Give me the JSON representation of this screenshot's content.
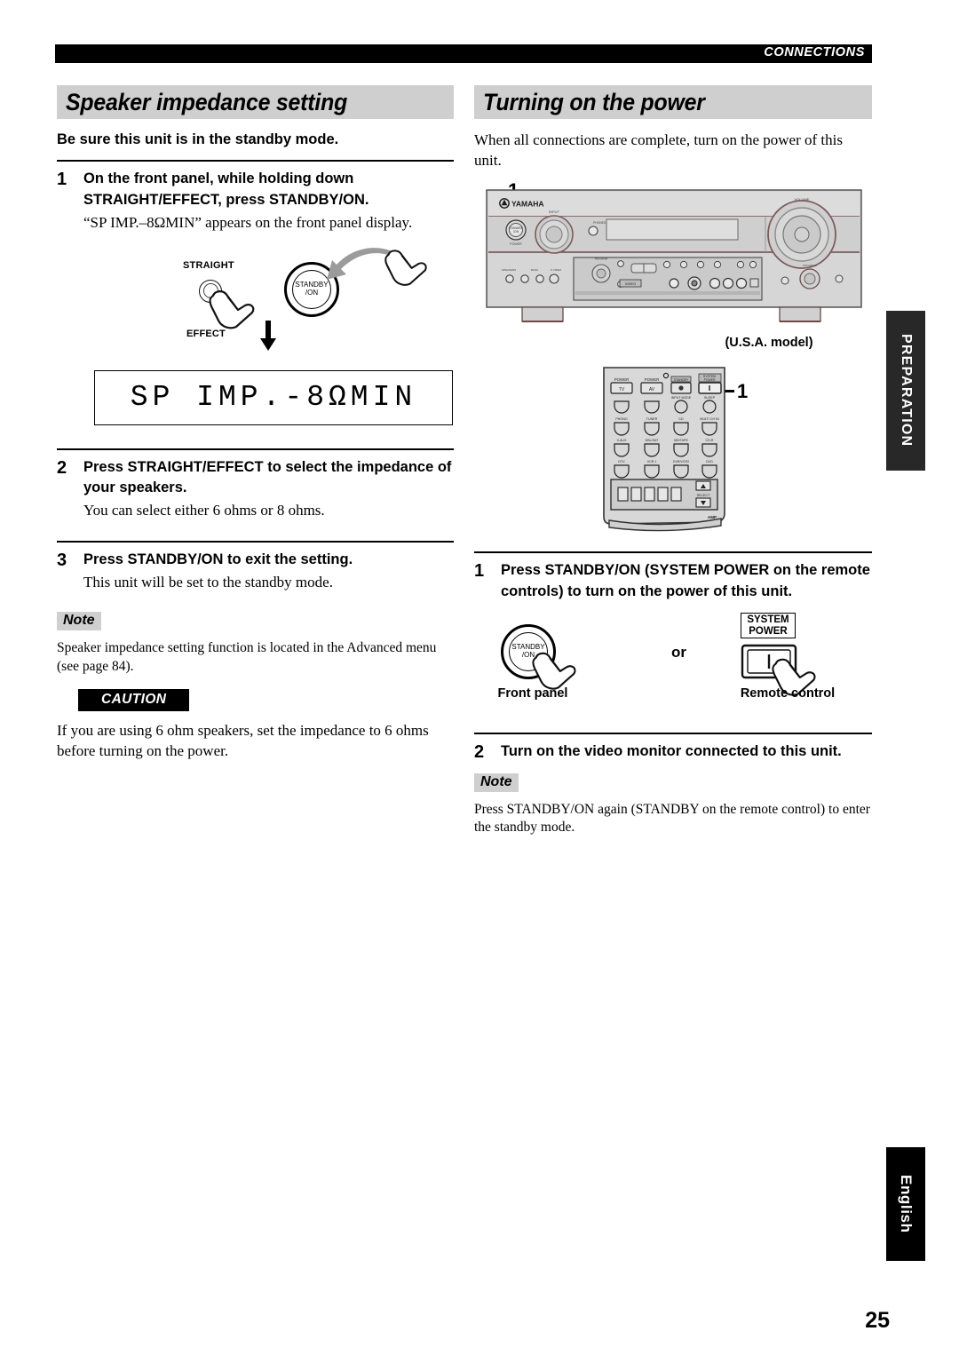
{
  "header": {
    "breadcrumb": "CONNECTIONS"
  },
  "page_number": "25",
  "side_tabs": {
    "preparation": "PREPARATION",
    "english": "English"
  },
  "left_column": {
    "section_title": "Speaker impedance setting",
    "intro": "Be sure this unit is in the standby mode.",
    "steps": [
      {
        "num": "1",
        "title": "On the front panel, while holding down STRAIGHT/EFFECT, press STANDBY/ON.",
        "desc": "“SP IMP.–8ΩMIN” appears on the front panel display."
      },
      {
        "num": "2",
        "title": "Press STRAIGHT/EFFECT to select the impedance of your speakers.",
        "desc": "You can select either 6 ohms or 8 ohms."
      },
      {
        "num": "3",
        "title": "Press STANDBY/ON to exit the setting.",
        "desc": "This unit will be set to the standby mode."
      }
    ],
    "diagram": {
      "label_straight": "STRAIGHT",
      "label_effect": "EFFECT",
      "label_standby_line1": "STANDBY",
      "label_standby_line2": "/ON"
    },
    "display_text": "SP IMP.-8ΩMIN",
    "note_tag": "Note",
    "note_body": "Speaker impedance setting function is located in the Advanced menu (see page 84).",
    "caution_tag": "CAUTION",
    "caution_body": "If you are using 6 ohm speakers, set the impedance to 6 ohms before turning on the power."
  },
  "right_column": {
    "section_title": "Turning on the power",
    "intro": "When all connections are complete, turn on the power of this unit.",
    "callout_receiver": "1",
    "callout_remote": "1",
    "receiver": {
      "brand": "YAMAHA",
      "label_volume": "VOLUME",
      "label_input": "INPUT",
      "label_standby": "STANDBY/ON",
      "label_phones": "PHONES",
      "caption": "(U.S.A. model)"
    },
    "remote": {
      "buttons": [
        [
          "POWER",
          "TV"
        ],
        [
          "POWER",
          "AV"
        ],
        [
          "STANDBY",
          "●"
        ],
        [
          "SYSTEM POWER",
          "I"
        ]
      ],
      "row2": [
        "",
        "",
        "INPUT MODE",
        "SLEEP"
      ],
      "row3": [
        "PHONO",
        "TUNER",
        "CD",
        "MULTI CH IN"
      ],
      "row4": [
        "V-AUX",
        "DBL/SAT",
        "MD/TAPE",
        "CD-R"
      ],
      "row5": [
        "DTV",
        "VCR 1",
        "DVR/VCR2",
        "DVD"
      ],
      "select_label": "SELECT",
      "amp_label": "AMP"
    },
    "steps": [
      {
        "num": "1",
        "title": "Press STANDBY/ON (SYSTEM POWER on the remote controls) to turn on the power of this unit."
      },
      {
        "num": "2",
        "title": "Turn on the video monitor connected to this unit."
      }
    ],
    "or_diagram": {
      "standby_line1": "STANDBY",
      "standby_line2": "/ON",
      "or": "or",
      "front_panel_caption": "Front panel",
      "remote_caption": "Remote control",
      "system_power_line1": "SYSTEM",
      "system_power_line2": "POWER",
      "power_symbol": "I"
    },
    "note_tag": "Note",
    "note_body": "Press STANDBY/ON again (STANDBY on the remote control) to enter the standby mode."
  }
}
